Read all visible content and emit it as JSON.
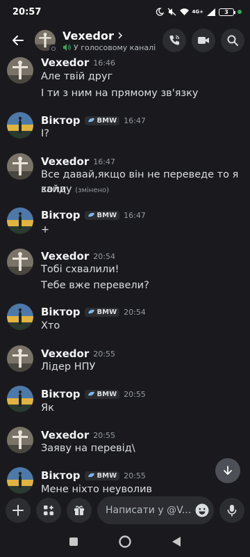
{
  "status_bar": {
    "time": "20:57",
    "battery": "3",
    "network": "4G+"
  },
  "header": {
    "name": "Vexedor",
    "subtitle": "У голосовому каналі"
  },
  "composer": {
    "placeholder": "Написати у @V..."
  },
  "messages": [
    {
      "author": "Vexedor",
      "time": "16:46",
      "bmw": false,
      "lines": [
        "Але твій друг",
        "І ти з ним на прямому зв'язку"
      ]
    },
    {
      "author": "Віктор",
      "time": "16:47",
      "bmw": true,
      "tag": "BMW",
      "lines": [
        "І?"
      ]
    },
    {
      "author": "Vexedor",
      "time": "16:47",
      "bmw": false,
      "lines": [
        "Все давай,якщо він не переведе то я коли",
        "зайду"
      ],
      "edited": "(змінено)"
    },
    {
      "author": "Віктор",
      "time": "16:47",
      "bmw": true,
      "tag": "BMW",
      "lines": [
        "+"
      ]
    },
    {
      "author": "Vexedor",
      "time": "20:54",
      "bmw": false,
      "lines": [
        "Тобі схвалили!",
        "Тебе вже перевели?"
      ]
    },
    {
      "author": "Віктор",
      "time": "20:54",
      "bmw": true,
      "tag": "BMW",
      "lines": [
        "Хто"
      ]
    },
    {
      "author": "Vexedor",
      "time": "20:55",
      "bmw": false,
      "lines": [
        "Лідер НПУ"
      ]
    },
    {
      "author": "Віктор",
      "time": "20:55",
      "bmw": true,
      "tag": "BMW",
      "lines": [
        "Як"
      ]
    },
    {
      "author": "Vexedor",
      "time": "20:55",
      "bmw": false,
      "lines": [
        "Заяву на перевід\\"
      ]
    },
    {
      "author": "Віктор",
      "time": "20:55",
      "bmw": true,
      "tag": "BMW",
      "lines": [
        "Мене ніхто неуволив"
      ]
    }
  ]
}
